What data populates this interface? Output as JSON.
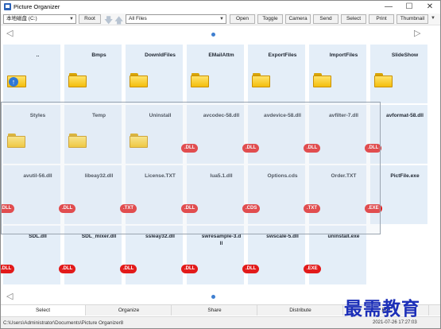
{
  "window": {
    "title": "Picture Organizer"
  },
  "toolbar": {
    "drive": "本地磁盘 (C:)",
    "root": "Root",
    "filter": "All Files",
    "buttons": [
      "Open",
      "Toggle",
      "Camera",
      "Send",
      "Select",
      "Print",
      "Thumbnail"
    ]
  },
  "tiles": [
    {
      "label": "..",
      "icon": "up-folder-icon"
    },
    {
      "label": "Bmps",
      "icon": "folder-icon"
    },
    {
      "label": "DownldFiles",
      "icon": "folder-icon"
    },
    {
      "label": "EMailAttm",
      "icon": "folder-icon"
    },
    {
      "label": "ExportFiles",
      "icon": "folder-icon"
    },
    {
      "label": "ImportFiles",
      "icon": "folder-icon"
    },
    {
      "label": "SlideShow",
      "icon": "folder-icon"
    },
    {
      "label": "Styles",
      "icon": "folder-icon"
    },
    {
      "label": "Temp",
      "icon": "folder-icon"
    },
    {
      "label": "Uninstall",
      "icon": "folder-icon"
    },
    {
      "label": "avcodec-58.dll",
      "badge": ".DLL"
    },
    {
      "label": "avdevice-58.dll",
      "badge": ".DLL"
    },
    {
      "label": "avfilter-7.dll",
      "badge": ".DLL"
    },
    {
      "label": "avformat-58.dll",
      "badge": ".DLL"
    },
    {
      "label": "avutil-56.dll",
      "badge": ".DLL"
    },
    {
      "label": "libeay32.dll",
      "badge": ".DLL"
    },
    {
      "label": "License.TXT",
      "badge": ".TXT"
    },
    {
      "label": "lua5.1.dll",
      "badge": ".DLL"
    },
    {
      "label": "Options.cds",
      "badge": ".CDS"
    },
    {
      "label": "Order.TXT",
      "badge": ".TXT"
    },
    {
      "label": "PictFile.exe",
      "badge": ".EXE"
    },
    {
      "label": "SDL.dll",
      "badge": ".DLL"
    },
    {
      "label": "SDL_mixer.dll",
      "badge": ".DLL"
    },
    {
      "label": "ssleay32.dll",
      "badge": ".DLL"
    },
    {
      "label": "swresample-3.dll",
      "badge": ".DLL"
    },
    {
      "label": "swscale-5.dll",
      "badge": ".DLL"
    },
    {
      "label": "uninstall.exe",
      "badge": ".EXE"
    }
  ],
  "tabs": [
    "Select",
    "Organize",
    "Share",
    "Distribute",
    "Edit"
  ],
  "status": {
    "path": "C:\\Users\\Administrator\\Documents\\Picture Organizer8",
    "time": "2021-07-26 17:27:03"
  },
  "watermark": "最需教育",
  "colors": {
    "badge": "#e21a1a",
    "tile": "#e4eef8",
    "accent": "#3f7fd0",
    "watermark": "#1c2fb8"
  }
}
